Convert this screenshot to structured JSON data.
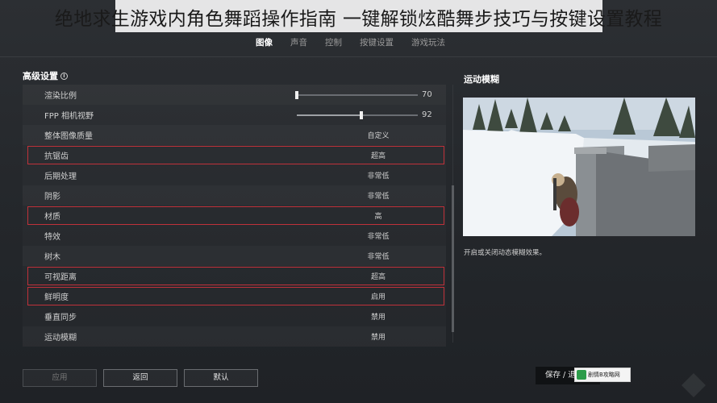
{
  "headline": "绝地求生游戏内角色舞蹈操作指南 一键解锁炫酷舞步技巧与按键设置教程",
  "tabs": [
    {
      "label": "图像",
      "active": true
    },
    {
      "label": "声音",
      "active": false
    },
    {
      "label": "控制",
      "active": false
    },
    {
      "label": "按键设置",
      "active": false
    },
    {
      "label": "游戏玩法",
      "active": false
    }
  ],
  "section": {
    "title": "高级设置",
    "info_icon": "info-icon"
  },
  "settings": [
    {
      "label": "渲染比例",
      "type": "slider",
      "value": "70",
      "fraction": 0.0,
      "highlighted": false
    },
    {
      "label": "FPP 相机视野",
      "type": "slider",
      "value": "92",
      "fraction": 0.53,
      "highlighted": false
    },
    {
      "label": "整体图像质量",
      "type": "text",
      "value": "自定义",
      "highlighted": false
    },
    {
      "label": "抗锯齿",
      "type": "text",
      "value": "超高",
      "highlighted": true
    },
    {
      "label": "后期处理",
      "type": "text",
      "value": "非常低",
      "highlighted": false
    },
    {
      "label": "阴影",
      "type": "text",
      "value": "非常低",
      "highlighted": false
    },
    {
      "label": "材质",
      "type": "text",
      "value": "高",
      "highlighted": true
    },
    {
      "label": "特效",
      "type": "text",
      "value": "非常低",
      "highlighted": false
    },
    {
      "label": "树木",
      "type": "text",
      "value": "非常低",
      "highlighted": false
    },
    {
      "label": "可视距离",
      "type": "text",
      "value": "超高",
      "highlighted": true
    },
    {
      "label": "鲜明度",
      "type": "text",
      "value": "启用",
      "highlighted": true
    },
    {
      "label": "垂直同步",
      "type": "text",
      "value": "禁用",
      "highlighted": false
    },
    {
      "label": "运动模糊",
      "type": "text",
      "value": "禁用",
      "highlighted": false
    }
  ],
  "panel": {
    "title": "运动模糊",
    "description": "开启或关闭动态模糊效果。"
  },
  "buttons": {
    "apply": "应用",
    "back": "返回",
    "default": "默认",
    "save": "保存 / 退"
  },
  "watermark": {
    "text": "剧情B攻略网"
  },
  "colors": {
    "highlight": "#c0313a",
    "background": "#25282c"
  }
}
